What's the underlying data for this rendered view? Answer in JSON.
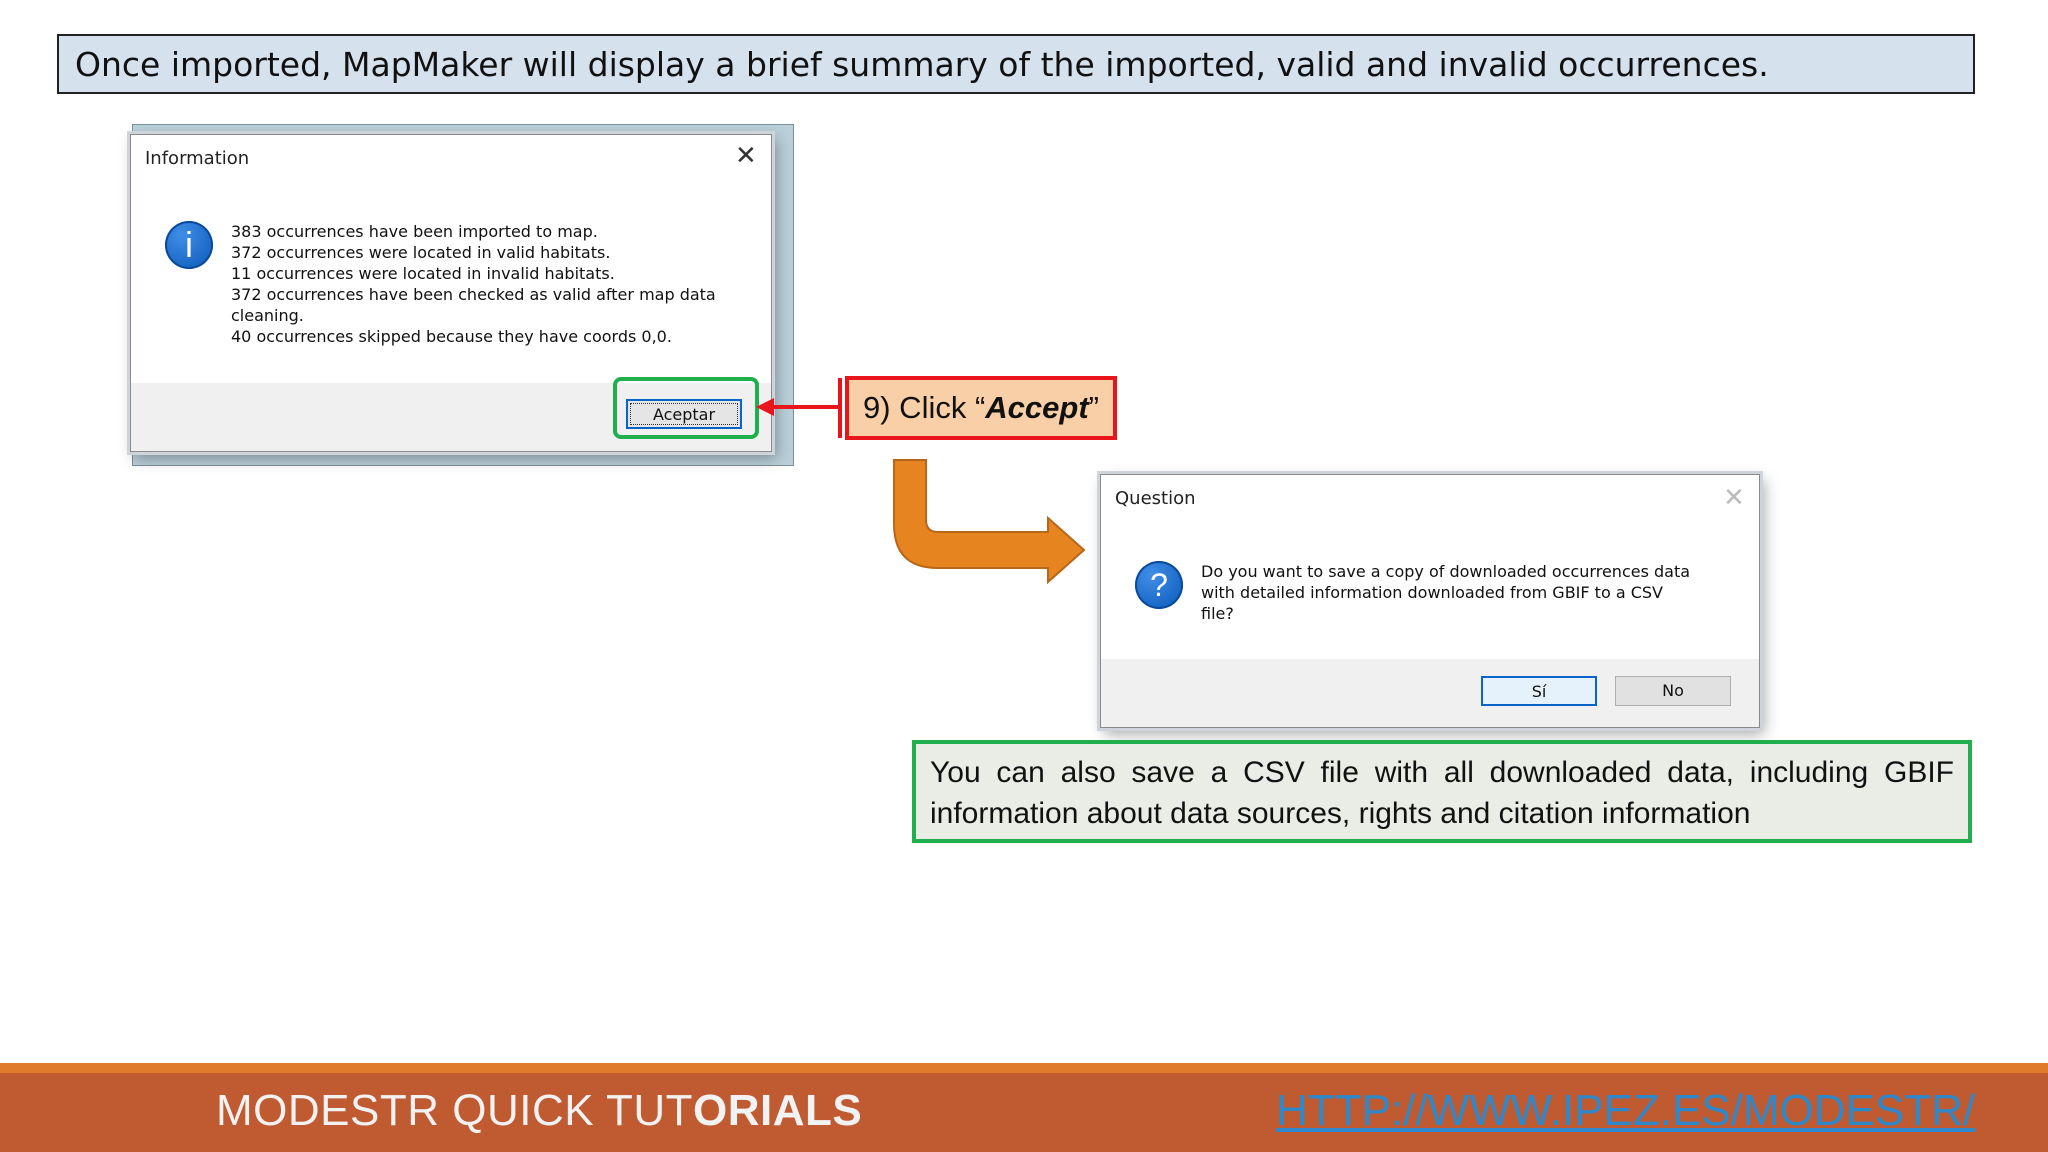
{
  "banner": {
    "text": "Once imported, MapMaker will display a brief summary of the imported, valid and invalid occurrences."
  },
  "info_dialog": {
    "title": "Information",
    "close_glyph": "✕",
    "icon_glyph": "i",
    "lines": [
      "383 occurrences have been imported to map.",
      "372 occurrences were located in valid habitats.",
      "11 occurrences were located in invalid habitats.",
      "372 occurrences have been checked as valid after map data",
      "cleaning.",
      "40 occurrences skipped because they have coords 0,0."
    ],
    "button_label": "Aceptar"
  },
  "step_callout": {
    "prefix": "9) Click “",
    "emphasis": "Accept",
    "suffix": "”"
  },
  "question_dialog": {
    "title": "Question",
    "close_glyph": "✕",
    "icon_glyph": "?",
    "lines": [
      "Do you want to save a copy of downloaded occurrences data",
      "with detailed information downloaded from GBIF to a CSV",
      "file?"
    ],
    "yes_label": "Sí",
    "no_label": "No"
  },
  "note": {
    "text": "You can also save a CSV file with all downloaded data, including GBIF information about data sources, rights and citation information"
  },
  "footer": {
    "left_normal": "MODESTR QUICK TUT",
    "left_bold": "ORIALS",
    "url": "HTTP://WWW.IPEZ.ES/MODESTR/"
  },
  "colors": {
    "accent_red": "#e8161b",
    "accent_green": "#21ae4d",
    "arrow_orange": "#e6851f",
    "footer_bg": "#bf5a31",
    "link_blue": "#2f88c9"
  }
}
